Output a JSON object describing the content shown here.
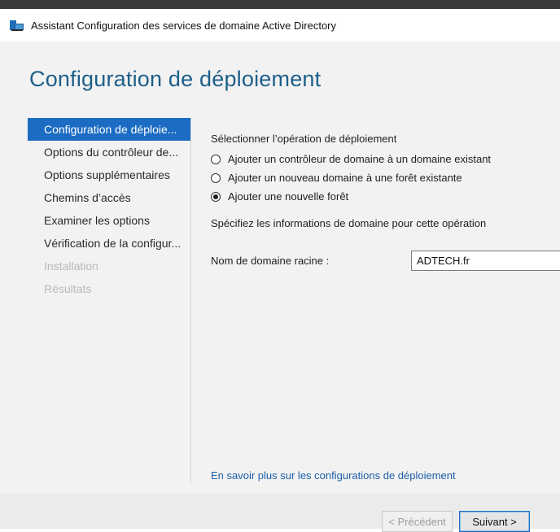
{
  "window": {
    "title": "Assistant Configuration des services de domaine Active Directory",
    "icon": "server-roles-icon"
  },
  "page": {
    "title": "Configuration de déploiement"
  },
  "sidebar": {
    "items": [
      {
        "label": "Configuration de déploie...",
        "state": "active"
      },
      {
        "label": "Options du contrôleur de...",
        "state": "normal"
      },
      {
        "label": "Options supplémentaires",
        "state": "normal"
      },
      {
        "label": "Chemins d’accès",
        "state": "normal"
      },
      {
        "label": "Examiner les options",
        "state": "normal"
      },
      {
        "label": "Vérification de la configur...",
        "state": "normal"
      },
      {
        "label": "Installation",
        "state": "disabled"
      },
      {
        "label": "Résultats",
        "state": "disabled"
      }
    ]
  },
  "deployment": {
    "section_label": "Sélectionner l’opération de déploiement",
    "options": [
      {
        "label": "Ajouter un contrôleur de domaine à un domaine existant",
        "checked": false
      },
      {
        "label": "Ajouter un nouveau domaine à une forêt existante",
        "checked": false
      },
      {
        "label": "Ajouter une nouvelle forêt",
        "checked": true
      }
    ]
  },
  "domain_info": {
    "section_label": "Spécifiez les informations de domaine pour cette opération",
    "root_domain_label": "Nom de domaine racine :",
    "root_domain_value": "ADTECH.fr"
  },
  "learn_more": {
    "label": "En savoir plus sur les configurations de déploiement"
  },
  "footer": {
    "prev_label": "< Précédent",
    "next_label": "Suivant >"
  },
  "colors": {
    "accent": "#1b6cc2",
    "title": "#1d5f8a",
    "link": "#1b5fa8",
    "disabled_text": "#b8b8b8"
  }
}
